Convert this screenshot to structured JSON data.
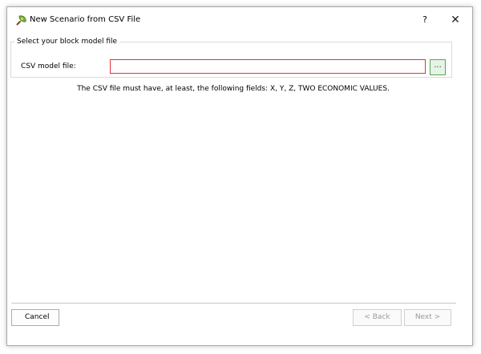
{
  "window": {
    "title": "New Scenario from CSV File",
    "help_label": "?",
    "close_label": "✕",
    "icon": "magnifier-leaf-icon"
  },
  "group": {
    "legend": "Select your block model file",
    "field_label": "CSV model file:",
    "field_value": "",
    "field_placeholder": "",
    "browse_label": "..."
  },
  "info": {
    "text": "The CSV file must have, at least, the following fields: X, Y, Z, TWO ECONOMIC VALUES."
  },
  "footer": {
    "cancel_label": "Cancel",
    "back_label": "< Back",
    "next_label": "Next >"
  },
  "colors": {
    "input_error_border": "#e0303a",
    "browse_bg": "#e6f4e6",
    "browse_border": "#5aa55a"
  }
}
